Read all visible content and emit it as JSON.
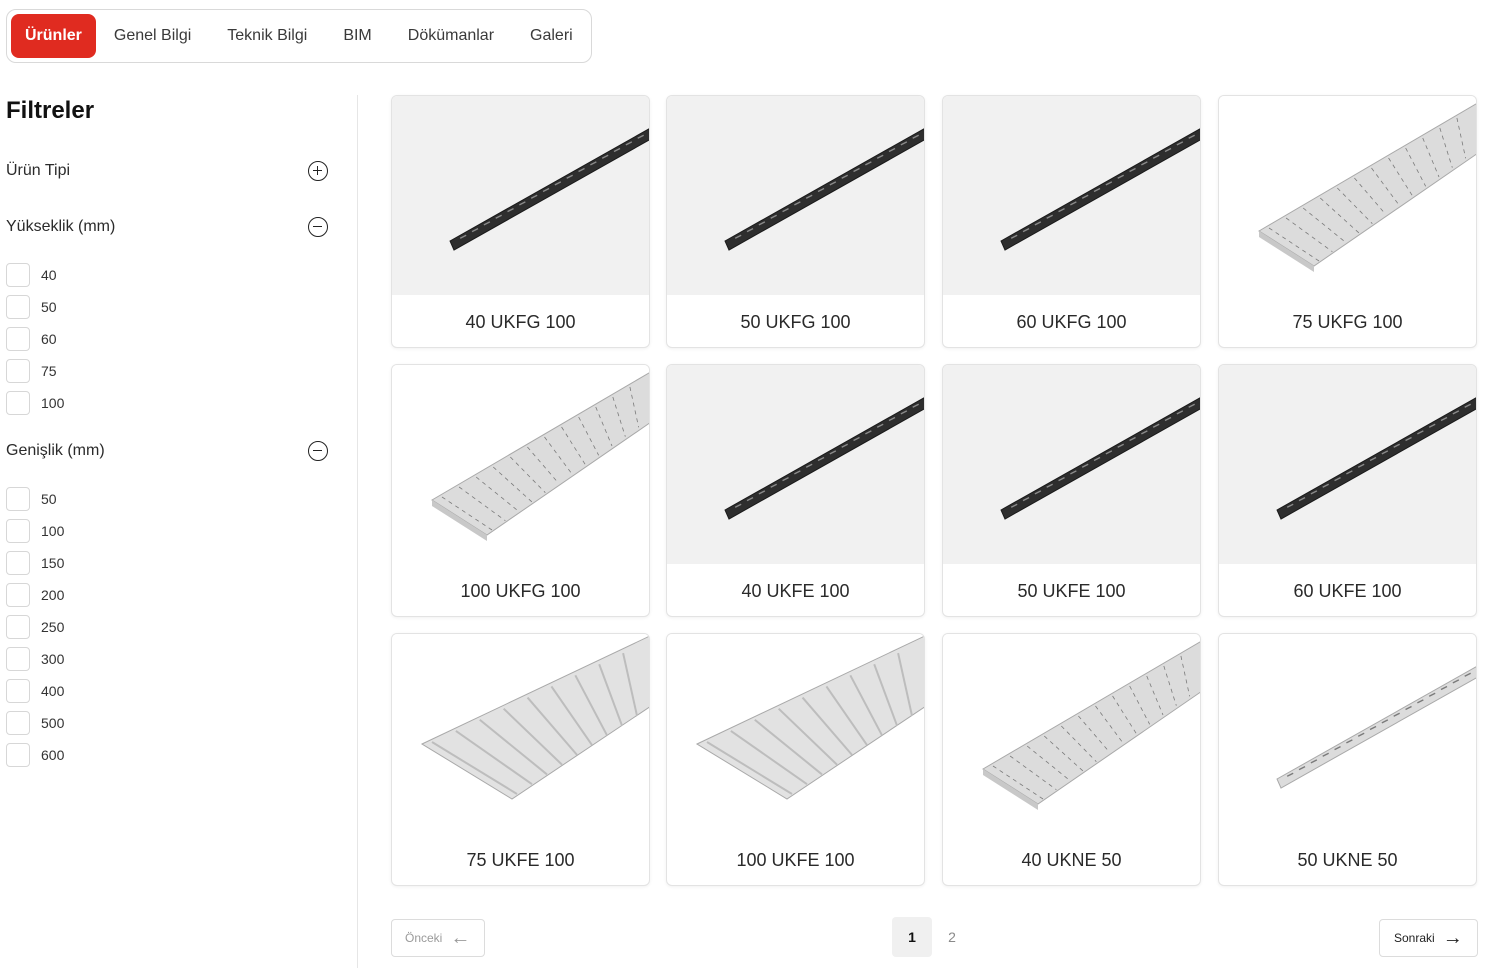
{
  "tabs": [
    {
      "label": "Ürünler",
      "active": true
    },
    {
      "label": "Genel Bilgi"
    },
    {
      "label": "Teknik Bilgi"
    },
    {
      "label": "BIM"
    },
    {
      "label": "Dökümanlar"
    },
    {
      "label": "Galeri"
    }
  ],
  "filters": {
    "title": "Filtreler",
    "groups": [
      {
        "label": "Ürün Tipi",
        "icon": "plus-circle-icon",
        "expanded": false,
        "options": []
      },
      {
        "label": "Yükseklik (mm)",
        "icon": "minus-circle-icon",
        "expanded": true,
        "options": [
          "40",
          "50",
          "60",
          "75",
          "100"
        ]
      },
      {
        "label": "Genişlik (mm)",
        "icon": "minus-circle-icon",
        "expanded": true,
        "options": [
          "50",
          "100",
          "150",
          "200",
          "250",
          "300",
          "400",
          "500",
          "600"
        ]
      }
    ]
  },
  "products": [
    {
      "name": "40 UKFG 100",
      "finish": "dark",
      "bg": "#f1f1f1",
      "shape": "channel"
    },
    {
      "name": "50 UKFG 100",
      "finish": "dark",
      "bg": "#f1f1f1",
      "shape": "channel"
    },
    {
      "name": "60 UKFG 100",
      "finish": "dark",
      "bg": "#f1f1f1",
      "shape": "channel"
    },
    {
      "name": "75 UKFG 100",
      "finish": "light",
      "bg": "#ffffff",
      "shape": "tray"
    },
    {
      "name": "100 UKFG 100",
      "finish": "light",
      "bg": "#ffffff",
      "shape": "tray"
    },
    {
      "name": "40 UKFE 100",
      "finish": "dark",
      "bg": "#f1f1f1",
      "shape": "channel"
    },
    {
      "name": "50 UKFE 100",
      "finish": "dark",
      "bg": "#f1f1f1",
      "shape": "channel"
    },
    {
      "name": "60 UKFE 100",
      "finish": "dark",
      "bg": "#f1f1f1",
      "shape": "channel"
    },
    {
      "name": "75 UKFE 100",
      "finish": "light",
      "bg": "#ffffff",
      "shape": "wide"
    },
    {
      "name": "100 UKFE 100",
      "finish": "light",
      "bg": "#ffffff",
      "shape": "wide"
    },
    {
      "name": "40 UKNE 50",
      "finish": "light",
      "bg": "#ffffff",
      "shape": "tray"
    },
    {
      "name": "50 UKNE 50",
      "finish": "light",
      "bg": "#ffffff",
      "shape": "channel"
    }
  ],
  "pagination": {
    "prev_label": "Önceki",
    "next_label": "Sonraki",
    "pages": [
      "1",
      "2"
    ],
    "current": "1"
  },
  "colors": {
    "accent": "#e02b20",
    "dark_tray": "#2e2e2e",
    "light_tray": "#d9d9d9"
  }
}
